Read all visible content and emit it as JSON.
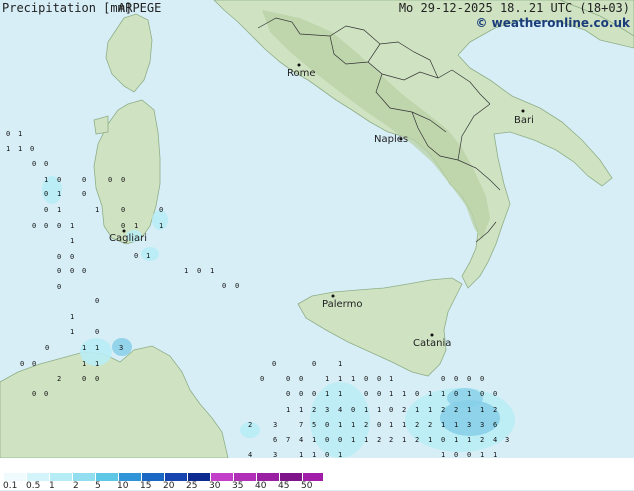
{
  "title": "Precipitation [mm]",
  "model": "ARPEGE",
  "valid_time": "Mo 29-12-2025 18..21 UTC (18+03)",
  "credit": "© weatheronline.co.uk",
  "colors": {
    "sea": "#d7eef7",
    "land": "#cfe3c2",
    "highland": "#b9d1a6",
    "border": "#333333",
    "precip_light": "#b8ecf5",
    "precip_mid": "#88cfe9"
  },
  "cities": [
    "Rome",
    "Naples",
    "Bari",
    "Palermo",
    "Catania",
    "Cagliari"
  ],
  "legend": {
    "ticks": [
      "0.1",
      "0.5",
      "1",
      "2",
      "5",
      "10",
      "15",
      "20",
      "25",
      "30",
      "35",
      "40",
      "45",
      "50"
    ],
    "colors": [
      "#f0fbfd",
      "#d2f4fa",
      "#b6ecf6",
      "#92def0",
      "#5fc7e6",
      "#2f95d8",
      "#1b68c4",
      "#1645b0",
      "#0d2a90",
      "#c43fc9",
      "#b12eb6",
      "#9a1fa2",
      "#7f148a",
      "#a11ca8"
    ]
  },
  "grid_numbers": [
    "0",
    "1",
    "1",
    "1",
    "0",
    "0",
    "0",
    "1",
    "0",
    "0",
    "1",
    "0",
    "1",
    "0",
    "0",
    "0",
    "1",
    "1",
    "0",
    "0",
    "0",
    "0",
    "0",
    "0",
    "0",
    "1",
    "1",
    "0",
    "0",
    "0",
    "0",
    "0",
    "1",
    "0",
    "0",
    "0",
    "1",
    "1",
    "0",
    "1",
    "1",
    "0",
    "1",
    "0",
    "0",
    "1",
    "1",
    "3",
    "0",
    "0",
    "0",
    "1",
    "1",
    "2",
    "0",
    "0",
    "0",
    "0",
    "0",
    "0",
    "1",
    "0",
    "0",
    "0",
    "1",
    "1",
    "1",
    "0",
    "0",
    "1",
    "0",
    "0",
    "0",
    "0",
    "0",
    "0",
    "0",
    "1",
    "1",
    "0",
    "0",
    "1",
    "1",
    "0",
    "1",
    "1",
    "0",
    "1",
    "0",
    "0",
    "1",
    "1",
    "2",
    "3",
    "4",
    "0",
    "1",
    "1",
    "0",
    "2",
    "1",
    "1",
    "2",
    "2",
    "1",
    "1",
    "2",
    "2",
    "3",
    "7",
    "5",
    "0",
    "1",
    "1",
    "2",
    "0",
    "1",
    "1",
    "2",
    "2",
    "1",
    "1",
    "3",
    "3",
    "6",
    "6",
    "7",
    "4",
    "1",
    "0",
    "0",
    "1",
    "1",
    "2",
    "2",
    "1",
    "2",
    "1",
    "0",
    "1",
    "1",
    "2",
    "4",
    "3",
    "4",
    "3",
    "1",
    "1",
    "0",
    "1",
    "1",
    "0",
    "0",
    "1",
    "1",
    "2",
    "1",
    "0",
    "0",
    "0",
    "3",
    "3",
    "5",
    "3"
  ]
}
